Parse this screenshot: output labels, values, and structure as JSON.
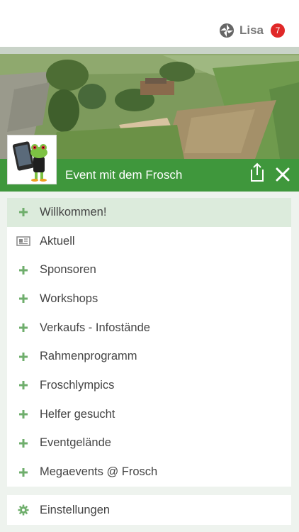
{
  "header": {
    "user_name": "Lisa",
    "notification_count": "7"
  },
  "event": {
    "title": "Event mit dem Frosch"
  },
  "menu": {
    "items": [
      {
        "label": "Willkommen!",
        "icon": "plus-icon",
        "active": true
      },
      {
        "label": "Aktuell",
        "icon": "newspaper-icon",
        "active": false
      },
      {
        "label": "Sponsoren",
        "icon": "plus-icon",
        "active": false
      },
      {
        "label": "Workshops",
        "icon": "plus-icon",
        "active": false
      },
      {
        "label": "Verkaufs - Infostände",
        "icon": "plus-icon",
        "active": false
      },
      {
        "label": "Rahmenprogramm",
        "icon": "plus-icon",
        "active": false
      },
      {
        "label": "Froschlympics",
        "icon": "plus-icon",
        "active": false
      },
      {
        "label": "Helfer gesucht",
        "icon": "plus-icon",
        "active": false
      },
      {
        "label": "Eventgelände",
        "icon": "plus-icon",
        "active": false
      },
      {
        "label": "Megaevents @ Frosch",
        "icon": "plus-icon",
        "active": false
      }
    ]
  },
  "settings": {
    "label": "Einstellungen",
    "icon": "gear-icon"
  },
  "colors": {
    "brand_green": "#3f973c",
    "active_row": "#dcebdc",
    "badge_red": "#e02828"
  }
}
